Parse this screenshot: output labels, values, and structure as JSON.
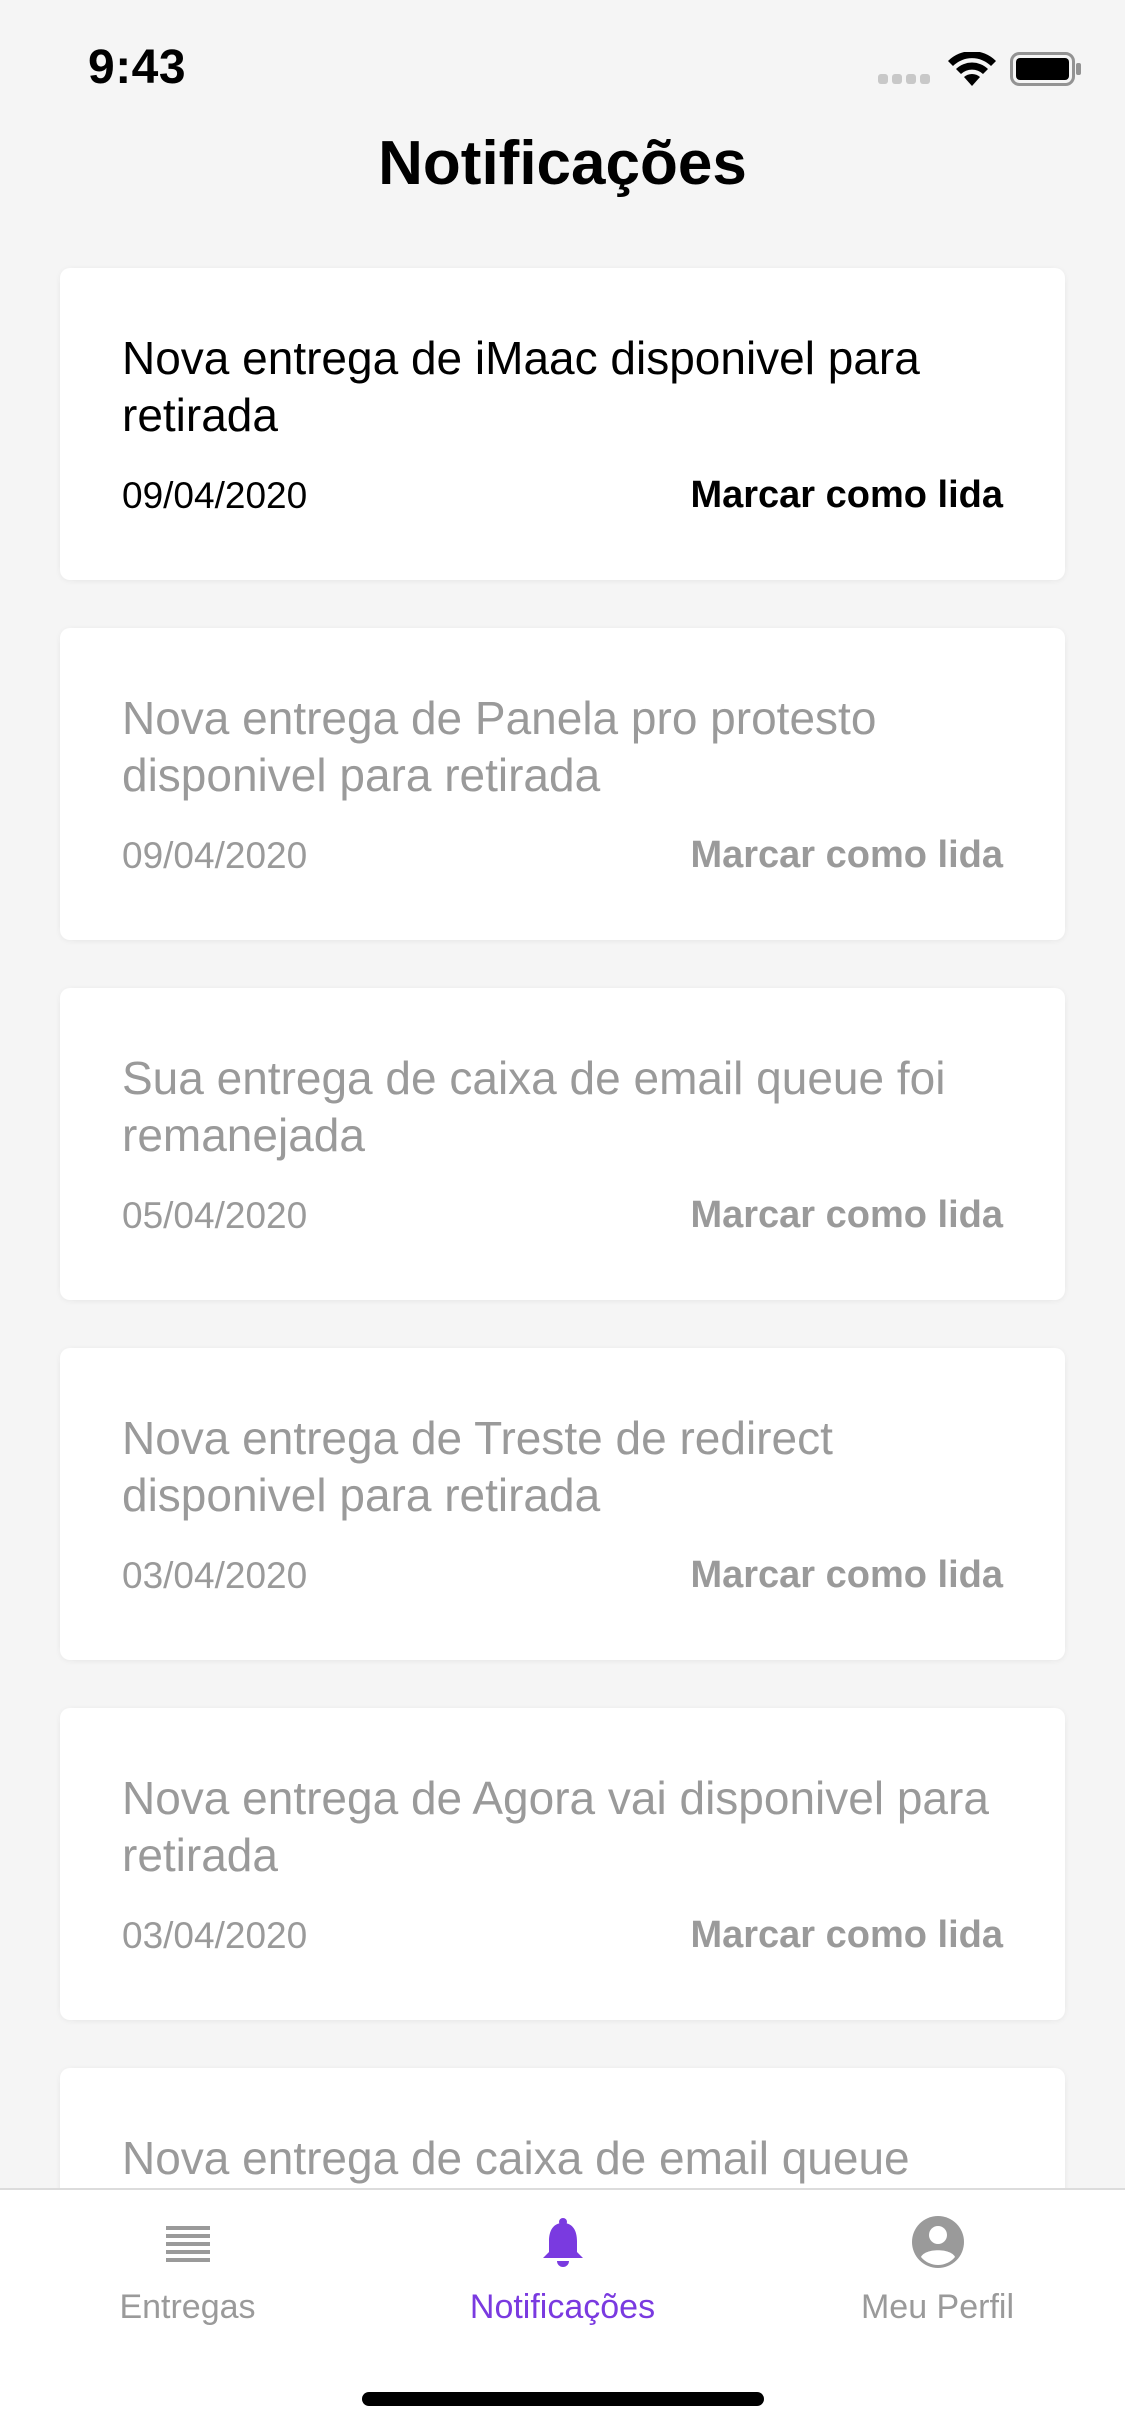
{
  "status_bar": {
    "time": "9:43"
  },
  "header": {
    "title": "Notificações"
  },
  "notifications": [
    {
      "text": "Nova entrega de iMaac disponivel para retirada",
      "date": "09/04/2020",
      "action": "Marcar como lida"
    },
    {
      "text": "Nova entrega de Panela pro protesto disponivel para retirada",
      "date": "09/04/2020",
      "action": "Marcar como lida"
    },
    {
      "text": "Sua entrega de caixa de email queue foi remanejada",
      "date": "05/04/2020",
      "action": "Marcar como lida"
    },
    {
      "text": "Nova entrega de Treste de redirect disponivel para retirada",
      "date": "03/04/2020",
      "action": "Marcar como lida"
    },
    {
      "text": "Nova entrega de Agora vai disponivel para retirada",
      "date": "03/04/2020",
      "action": "Marcar como lida"
    },
    {
      "text": "Nova entrega de caixa de email queue",
      "date": "",
      "action": ""
    }
  ],
  "tab_bar": {
    "tabs": [
      {
        "label": "Entregas",
        "icon": "list-icon"
      },
      {
        "label": "Notificações",
        "icon": "bell-icon"
      },
      {
        "label": "Meu Perfil",
        "icon": "account-icon"
      }
    ],
    "active_color": "#7a3ae0",
    "inactive_color": "#9a9a9a"
  }
}
